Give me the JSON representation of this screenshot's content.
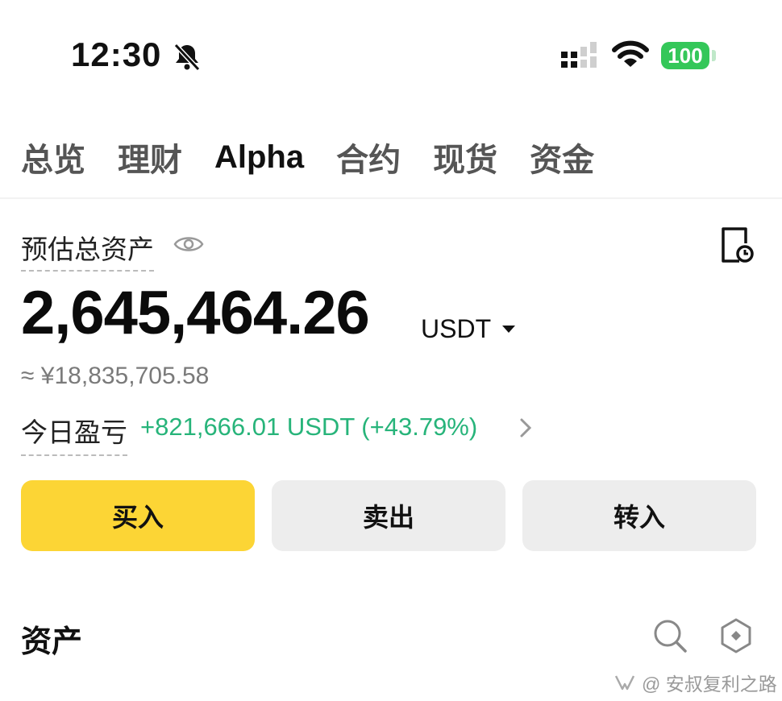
{
  "status_bar": {
    "time": "12:30",
    "battery": "100",
    "icons": [
      "bell-slash-icon",
      "signal-icon",
      "wifi-icon",
      "battery-icon"
    ],
    "battery_color": "#34c759"
  },
  "tabs": [
    {
      "label": "总览",
      "active": false
    },
    {
      "label": "理财",
      "active": false
    },
    {
      "label": "Alpha",
      "active": true
    },
    {
      "label": "合约",
      "active": false
    },
    {
      "label": "现货",
      "active": false
    },
    {
      "label": "资金",
      "active": false
    }
  ],
  "summary": {
    "estimated_label": "预估总资产",
    "total": "2,645,464.26",
    "unit": "USDT",
    "approx_cny": "≈ ¥18,835,705.58",
    "pnl_label": "今日盈亏",
    "pnl_value": "+821,666.01 USDT (+43.79%)",
    "pnl_color": "#27b47a"
  },
  "actions": {
    "buy": "买入",
    "sell": "卖出",
    "transfer": "转入",
    "buy_color": "#fcd535"
  },
  "assets": {
    "title": "资产"
  },
  "watermark": {
    "text": "@ 安叔复利之路"
  }
}
